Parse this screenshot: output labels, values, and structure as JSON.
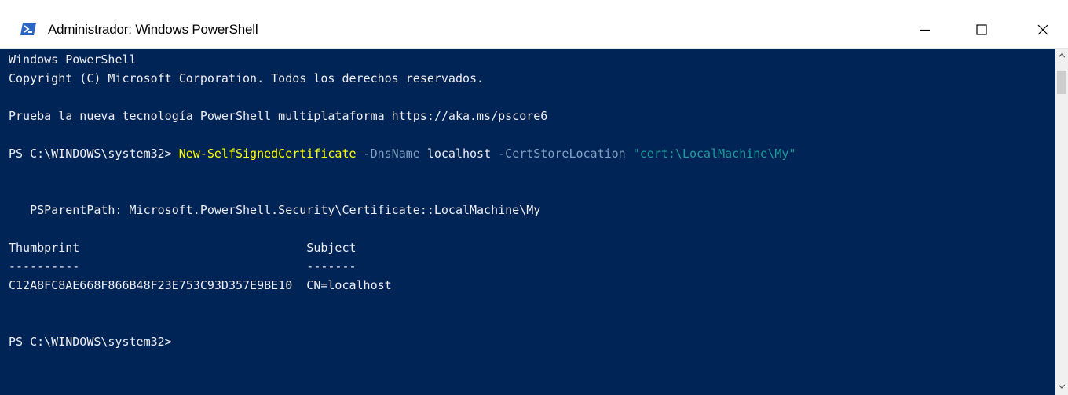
{
  "window": {
    "title": "Administrador: Windows PowerShell",
    "icon": "powershell-icon",
    "controls": [
      "minimize-icon",
      "maximize-icon",
      "close-icon"
    ]
  },
  "colors": {
    "console_bg": "#012456",
    "console_fg": "#EEEDF0",
    "command": "#FFFF00",
    "parameter": "#80A0C0",
    "string": "#1A9C9C"
  },
  "console": {
    "banner_line1": "Windows PowerShell",
    "banner_line2": "Copyright (C) Microsoft Corporation. Todos los derechos reservados.",
    "banner_line3": "Prueba la nueva tecnología PowerShell multiplataforma https://aka.ms/pscore6",
    "prompt1": "PS C:\\WINDOWS\\system32> ",
    "cmd_name": "New-SelfSignedCertificate",
    "param1_name": " -DnsName",
    "param1_value": " localhost",
    "param2_name": " -CertStoreLocation",
    "param2_value": " \"cert:\\LocalMachine\\My\"",
    "ps_parent_path": "   PSParentPath: Microsoft.PowerShell.Security\\Certificate::LocalMachine\\My",
    "table_header": "Thumbprint                                Subject",
    "table_separator": "----------                                -------",
    "table_row": "C12A8FC8AE668F866B48F23E753C93D357E9BE10  CN=localhost",
    "prompt2": "PS C:\\WINDOWS\\system32>"
  }
}
